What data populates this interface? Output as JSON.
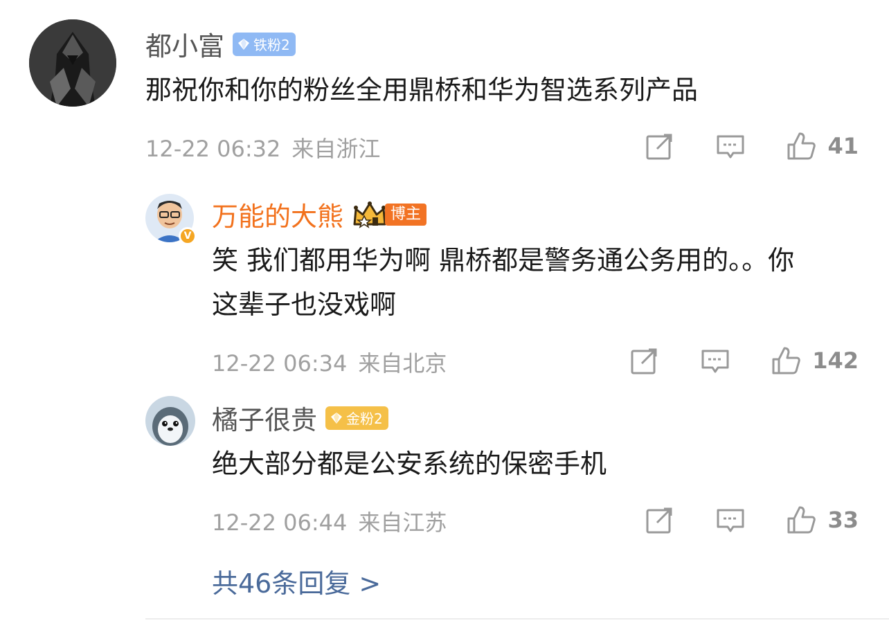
{
  "comments": [
    {
      "username": "都小富",
      "badge": "铁粉2",
      "text": "那祝你和你的粉丝全用鼎桥和华为智选系列产品",
      "time": "12-22 06:32",
      "location": "来自浙江",
      "likes": "41"
    },
    {
      "username": "万能的大熊",
      "badge": "博主",
      "verified_mark": "V",
      "text": "笑 我们都用华为啊 鼎桥都是警务通公务用的。。你这辈子也没戏啊",
      "time": "12-22 06:34",
      "location": "来自北京",
      "likes": "142"
    },
    {
      "username": "橘子很贵",
      "badge": "金粉2",
      "text": "绝大部分都是公安系统的保密手机",
      "time": "12-22 06:44",
      "location": "来自江苏",
      "likes": "33"
    }
  ],
  "more_replies": "共46条回复 >",
  "colors": {
    "vip_name": "#f2711c",
    "link": "#4a6a9a",
    "meta": "#a0a0a0"
  },
  "icons": [
    "share-icon",
    "comment-icon",
    "thumbs-up-icon"
  ]
}
